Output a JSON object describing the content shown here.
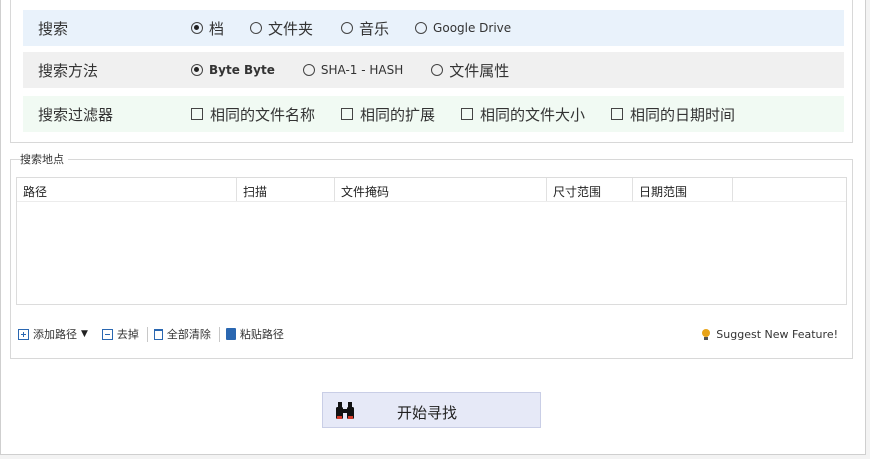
{
  "options": {
    "search": {
      "label": "搜索",
      "choices": [
        {
          "label": "档",
          "selected": true
        },
        {
          "label": "文件夹",
          "selected": false
        },
        {
          "label": "音乐",
          "selected": false
        },
        {
          "label": "Google Drive",
          "selected": false
        }
      ]
    },
    "method": {
      "label": "搜索方法",
      "choices": [
        {
          "label": "Byte Byte",
          "selected": true
        },
        {
          "label": "SHA-1 - HASH",
          "selected": false
        },
        {
          "label": "文件属性",
          "selected": false
        }
      ]
    },
    "filter": {
      "label": "搜索过滤器",
      "checks": [
        {
          "label": "相同的文件名称",
          "checked": false
        },
        {
          "label": "相同的扩展",
          "checked": false
        },
        {
          "label": "相同的文件大小",
          "checked": false
        },
        {
          "label": "相同的日期时间",
          "checked": false
        }
      ]
    }
  },
  "locations": {
    "group_title": "搜索地点",
    "columns": [
      "路径",
      "扫描",
      "文件掩码",
      "尺寸范围",
      "日期范围"
    ]
  },
  "toolbar": {
    "add_path": "添加路径",
    "remove": "去掉",
    "clear_all": "全部清除",
    "paste_path": "粘贴路径",
    "suggest": "Suggest New Feature!"
  },
  "start_button": {
    "label": "开始寻找"
  },
  "colors": {
    "search_row_bg": "#e9f2fb",
    "method_row_bg": "#f0f0f0",
    "filter_row_bg": "#f1faf3",
    "start_button_bg": "#e6e9f7",
    "icon_accent": "#2a67b1"
  }
}
